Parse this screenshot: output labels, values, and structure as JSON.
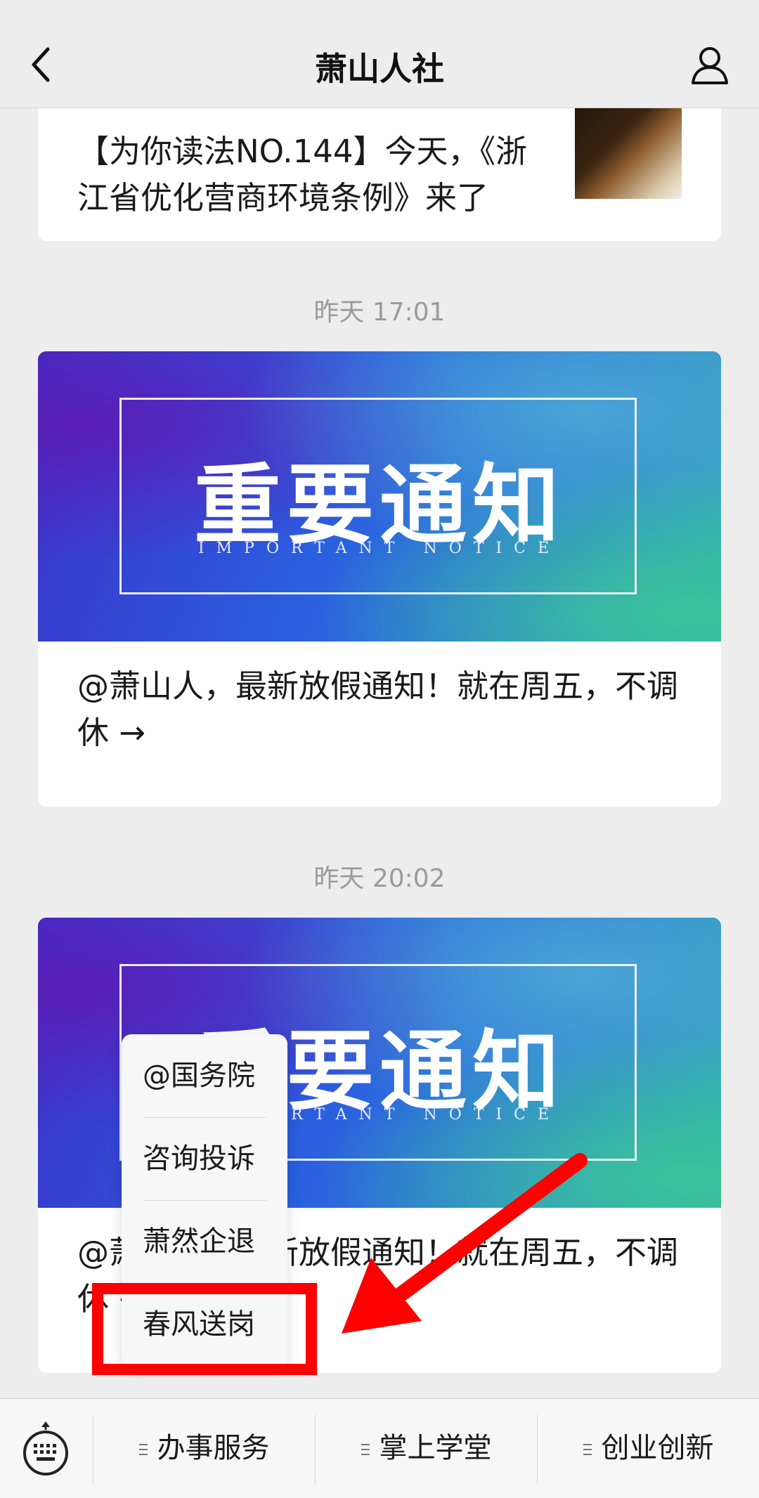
{
  "header": {
    "title": "萧山人社",
    "back_icon": "chevron-left-icon",
    "profile_icon": "person-icon"
  },
  "messages": [
    {
      "timestamp": "",
      "title": "【为你读法NO.144】今天，《浙江省优化营商环境条例》来了"
    },
    {
      "timestamp": "昨天 17:01",
      "banner_title": "重要通知",
      "banner_subtitle": "IMPORTANT NOTICE",
      "title": "@萧山人，最新放假通知！就在周五，不调休 →"
    },
    {
      "timestamp": "昨天 20:02",
      "banner_title": "重要通知",
      "banner_subtitle": "IMPORTANT NOTICE",
      "title": "@萧山人，最新放假通知！就在周五，不调休 →"
    }
  ],
  "popup_menu": {
    "items": [
      "@国务院",
      "咨询投诉",
      "萧然企退",
      "春风送岗"
    ],
    "highlighted": "春风送岗"
  },
  "bottom_menu": {
    "keyboard_icon": "keyboard-icon",
    "items": [
      "办事服务",
      "掌上学堂",
      "创业创新"
    ]
  },
  "colors": {
    "highlight": "#fe0000",
    "background": "#ededed"
  }
}
